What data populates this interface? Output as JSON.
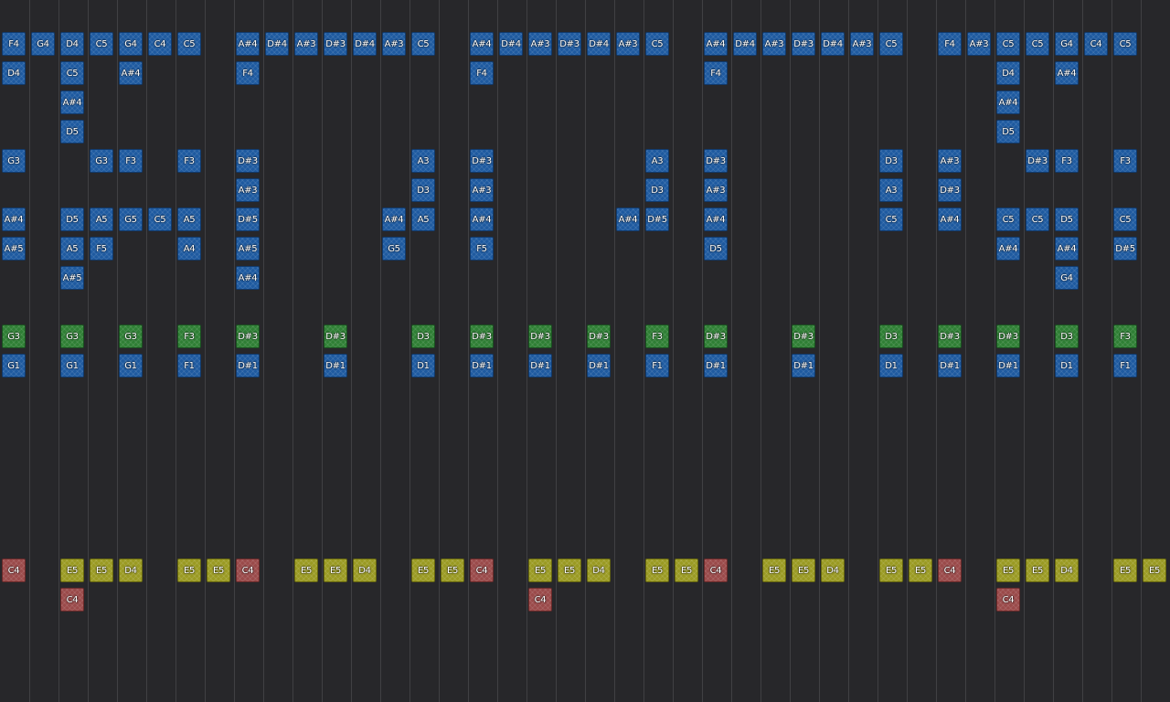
{
  "palette": {
    "background": "#27272a",
    "grid_line": "#404043",
    "blue": "#1e5aa0",
    "green": "#2f7f35",
    "yellow": "#9a9a22",
    "red": "#9a4a4a"
  },
  "columns": 40,
  "notes": [
    {
      "c": 0,
      "r": 0,
      "t": "F4",
      "k": "blue"
    },
    {
      "c": 1,
      "r": 0,
      "t": "G4",
      "k": "blue"
    },
    {
      "c": 2,
      "r": 0,
      "t": "D4",
      "k": "blue"
    },
    {
      "c": 3,
      "r": 0,
      "t": "C5",
      "k": "blue"
    },
    {
      "c": 4,
      "r": 0,
      "t": "G4",
      "k": "blue"
    },
    {
      "c": 5,
      "r": 0,
      "t": "C4",
      "k": "blue"
    },
    {
      "c": 6,
      "r": 0,
      "t": "C5",
      "k": "blue"
    },
    {
      "c": 8,
      "r": 0,
      "t": "A#4",
      "k": "blue"
    },
    {
      "c": 9,
      "r": 0,
      "t": "D#4",
      "k": "blue"
    },
    {
      "c": 10,
      "r": 0,
      "t": "A#3",
      "k": "blue"
    },
    {
      "c": 11,
      "r": 0,
      "t": "D#3",
      "k": "blue"
    },
    {
      "c": 12,
      "r": 0,
      "t": "D#4",
      "k": "blue"
    },
    {
      "c": 13,
      "r": 0,
      "t": "A#3",
      "k": "blue"
    },
    {
      "c": 14,
      "r": 0,
      "t": "C5",
      "k": "blue"
    },
    {
      "c": 16,
      "r": 0,
      "t": "A#4",
      "k": "blue"
    },
    {
      "c": 17,
      "r": 0,
      "t": "D#4",
      "k": "blue"
    },
    {
      "c": 18,
      "r": 0,
      "t": "A#3",
      "k": "blue"
    },
    {
      "c": 19,
      "r": 0,
      "t": "D#3",
      "k": "blue"
    },
    {
      "c": 20,
      "r": 0,
      "t": "D#4",
      "k": "blue"
    },
    {
      "c": 21,
      "r": 0,
      "t": "A#3",
      "k": "blue"
    },
    {
      "c": 22,
      "r": 0,
      "t": "C5",
      "k": "blue"
    },
    {
      "c": 24,
      "r": 0,
      "t": "A#4",
      "k": "blue"
    },
    {
      "c": 25,
      "r": 0,
      "t": "D#4",
      "k": "blue"
    },
    {
      "c": 26,
      "r": 0,
      "t": "A#3",
      "k": "blue"
    },
    {
      "c": 27,
      "r": 0,
      "t": "D#3",
      "k": "blue"
    },
    {
      "c": 28,
      "r": 0,
      "t": "D#4",
      "k": "blue"
    },
    {
      "c": 29,
      "r": 0,
      "t": "A#3",
      "k": "blue"
    },
    {
      "c": 30,
      "r": 0,
      "t": "C5",
      "k": "blue"
    },
    {
      "c": 32,
      "r": 0,
      "t": "F4",
      "k": "blue"
    },
    {
      "c": 33,
      "r": 0,
      "t": "A#3",
      "k": "blue"
    },
    {
      "c": 34,
      "r": 0,
      "t": "C5",
      "k": "blue"
    },
    {
      "c": 35,
      "r": 0,
      "t": "C5",
      "k": "blue"
    },
    {
      "c": 36,
      "r": 0,
      "t": "G4",
      "k": "blue"
    },
    {
      "c": 37,
      "r": 0,
      "t": "C4",
      "k": "blue"
    },
    {
      "c": 38,
      "r": 0,
      "t": "C5",
      "k": "blue"
    },
    {
      "c": 0,
      "r": 1,
      "t": "D4",
      "k": "blue"
    },
    {
      "c": 2,
      "r": 1,
      "t": "C5",
      "k": "blue"
    },
    {
      "c": 4,
      "r": 1,
      "t": "A#4",
      "k": "blue"
    },
    {
      "c": 8,
      "r": 1,
      "t": "F4",
      "k": "blue"
    },
    {
      "c": 16,
      "r": 1,
      "t": "F4",
      "k": "blue"
    },
    {
      "c": 24,
      "r": 1,
      "t": "F4",
      "k": "blue"
    },
    {
      "c": 34,
      "r": 1,
      "t": "D4",
      "k": "blue"
    },
    {
      "c": 36,
      "r": 1,
      "t": "A#4",
      "k": "blue"
    },
    {
      "c": 2,
      "r": 2,
      "t": "A#4",
      "k": "blue"
    },
    {
      "c": 34,
      "r": 2,
      "t": "A#4",
      "k": "blue"
    },
    {
      "c": 2,
      "r": 3,
      "t": "D5",
      "k": "blue"
    },
    {
      "c": 34,
      "r": 3,
      "t": "D5",
      "k": "blue"
    },
    {
      "c": 0,
      "r": 4,
      "t": "G3",
      "k": "blue"
    },
    {
      "c": 3,
      "r": 4,
      "t": "G3",
      "k": "blue"
    },
    {
      "c": 4,
      "r": 4,
      "t": "F3",
      "k": "blue"
    },
    {
      "c": 6,
      "r": 4,
      "t": "F3",
      "k": "blue"
    },
    {
      "c": 8,
      "r": 4,
      "t": "D#3",
      "k": "blue"
    },
    {
      "c": 14,
      "r": 4,
      "t": "A3",
      "k": "blue"
    },
    {
      "c": 16,
      "r": 4,
      "t": "D#3",
      "k": "blue"
    },
    {
      "c": 22,
      "r": 4,
      "t": "A3",
      "k": "blue"
    },
    {
      "c": 24,
      "r": 4,
      "t": "D#3",
      "k": "blue"
    },
    {
      "c": 30,
      "r": 4,
      "t": "D3",
      "k": "blue"
    },
    {
      "c": 32,
      "r": 4,
      "t": "A#3",
      "k": "blue"
    },
    {
      "c": 35,
      "r": 4,
      "t": "D#3",
      "k": "blue"
    },
    {
      "c": 36,
      "r": 4,
      "t": "F3",
      "k": "blue"
    },
    {
      "c": 38,
      "r": 4,
      "t": "F3",
      "k": "blue"
    },
    {
      "c": 8,
      "r": 5,
      "t": "A#3",
      "k": "blue"
    },
    {
      "c": 14,
      "r": 5,
      "t": "D3",
      "k": "blue"
    },
    {
      "c": 16,
      "r": 5,
      "t": "A#3",
      "k": "blue"
    },
    {
      "c": 22,
      "r": 5,
      "t": "D3",
      "k": "blue"
    },
    {
      "c": 24,
      "r": 5,
      "t": "A#3",
      "k": "blue"
    },
    {
      "c": 30,
      "r": 5,
      "t": "A3",
      "k": "blue"
    },
    {
      "c": 32,
      "r": 5,
      "t": "D#3",
      "k": "blue"
    },
    {
      "c": 0,
      "r": 6,
      "t": "A#4",
      "k": "blue"
    },
    {
      "c": 2,
      "r": 6,
      "t": "D5",
      "k": "blue"
    },
    {
      "c": 3,
      "r": 6,
      "t": "A5",
      "k": "blue"
    },
    {
      "c": 4,
      "r": 6,
      "t": "G5",
      "k": "blue"
    },
    {
      "c": 5,
      "r": 6,
      "t": "C5",
      "k": "blue"
    },
    {
      "c": 6,
      "r": 6,
      "t": "A5",
      "k": "blue"
    },
    {
      "c": 8,
      "r": 6,
      "t": "D#5",
      "k": "blue"
    },
    {
      "c": 13,
      "r": 6,
      "t": "A#4",
      "k": "blue"
    },
    {
      "c": 14,
      "r": 6,
      "t": "A5",
      "k": "blue"
    },
    {
      "c": 16,
      "r": 6,
      "t": "A#4",
      "k": "blue"
    },
    {
      "c": 21,
      "r": 6,
      "t": "A#4",
      "k": "blue"
    },
    {
      "c": 22,
      "r": 6,
      "t": "D#5",
      "k": "blue"
    },
    {
      "c": 24,
      "r": 6,
      "t": "A#4",
      "k": "blue"
    },
    {
      "c": 30,
      "r": 6,
      "t": "C5",
      "k": "blue"
    },
    {
      "c": 32,
      "r": 6,
      "t": "A#4",
      "k": "blue"
    },
    {
      "c": 34,
      "r": 6,
      "t": "C5",
      "k": "blue"
    },
    {
      "c": 35,
      "r": 6,
      "t": "C5",
      "k": "blue"
    },
    {
      "c": 36,
      "r": 6,
      "t": "D5",
      "k": "blue"
    },
    {
      "c": 38,
      "r": 6,
      "t": "C5",
      "k": "blue"
    },
    {
      "c": 0,
      "r": 7,
      "t": "A#5",
      "k": "blue"
    },
    {
      "c": 2,
      "r": 7,
      "t": "A5",
      "k": "blue"
    },
    {
      "c": 3,
      "r": 7,
      "t": "F5",
      "k": "blue"
    },
    {
      "c": 6,
      "r": 7,
      "t": "A4",
      "k": "blue"
    },
    {
      "c": 8,
      "r": 7,
      "t": "A#5",
      "k": "blue"
    },
    {
      "c": 13,
      "r": 7,
      "t": "G5",
      "k": "blue"
    },
    {
      "c": 16,
      "r": 7,
      "t": "F5",
      "k": "blue"
    },
    {
      "c": 24,
      "r": 7,
      "t": "D5",
      "k": "blue"
    },
    {
      "c": 34,
      "r": 7,
      "t": "A#4",
      "k": "blue"
    },
    {
      "c": 36,
      "r": 7,
      "t": "A#4",
      "k": "blue"
    },
    {
      "c": 38,
      "r": 7,
      "t": "D#5",
      "k": "blue"
    },
    {
      "c": 2,
      "r": 8,
      "t": "A#5",
      "k": "blue"
    },
    {
      "c": 8,
      "r": 8,
      "t": "A#4",
      "k": "blue"
    },
    {
      "c": 36,
      "r": 8,
      "t": "G4",
      "k": "blue"
    },
    {
      "c": 0,
      "r": 10,
      "t": "G3",
      "k": "green"
    },
    {
      "c": 2,
      "r": 10,
      "t": "G3",
      "k": "green"
    },
    {
      "c": 4,
      "r": 10,
      "t": "G3",
      "k": "green"
    },
    {
      "c": 6,
      "r": 10,
      "t": "F3",
      "k": "green"
    },
    {
      "c": 8,
      "r": 10,
      "t": "D#3",
      "k": "green"
    },
    {
      "c": 11,
      "r": 10,
      "t": "D#3",
      "k": "green"
    },
    {
      "c": 14,
      "r": 10,
      "t": "D3",
      "k": "green"
    },
    {
      "c": 16,
      "r": 10,
      "t": "D#3",
      "k": "green"
    },
    {
      "c": 18,
      "r": 10,
      "t": "D#3",
      "k": "green"
    },
    {
      "c": 20,
      "r": 10,
      "t": "D#3",
      "k": "green"
    },
    {
      "c": 22,
      "r": 10,
      "t": "F3",
      "k": "green"
    },
    {
      "c": 24,
      "r": 10,
      "t": "D#3",
      "k": "green"
    },
    {
      "c": 27,
      "r": 10,
      "t": "D#3",
      "k": "green"
    },
    {
      "c": 30,
      "r": 10,
      "t": "D3",
      "k": "green"
    },
    {
      "c": 32,
      "r": 10,
      "t": "D#3",
      "k": "green"
    },
    {
      "c": 34,
      "r": 10,
      "t": "D#3",
      "k": "green"
    },
    {
      "c": 36,
      "r": 10,
      "t": "D3",
      "k": "green"
    },
    {
      "c": 38,
      "r": 10,
      "t": "F3",
      "k": "green"
    },
    {
      "c": 0,
      "r": 11,
      "t": "G1",
      "k": "blue"
    },
    {
      "c": 2,
      "r": 11,
      "t": "G1",
      "k": "blue"
    },
    {
      "c": 4,
      "r": 11,
      "t": "G1",
      "k": "blue"
    },
    {
      "c": 6,
      "r": 11,
      "t": "F1",
      "k": "blue"
    },
    {
      "c": 8,
      "r": 11,
      "t": "D#1",
      "k": "blue"
    },
    {
      "c": 11,
      "r": 11,
      "t": "D#1",
      "k": "blue"
    },
    {
      "c": 14,
      "r": 11,
      "t": "D1",
      "k": "blue"
    },
    {
      "c": 16,
      "r": 11,
      "t": "D#1",
      "k": "blue"
    },
    {
      "c": 18,
      "r": 11,
      "t": "D#1",
      "k": "blue"
    },
    {
      "c": 20,
      "r": 11,
      "t": "D#1",
      "k": "blue"
    },
    {
      "c": 22,
      "r": 11,
      "t": "F1",
      "k": "blue"
    },
    {
      "c": 24,
      "r": 11,
      "t": "D#1",
      "k": "blue"
    },
    {
      "c": 27,
      "r": 11,
      "t": "D#1",
      "k": "blue"
    },
    {
      "c": 30,
      "r": 11,
      "t": "D1",
      "k": "blue"
    },
    {
      "c": 32,
      "r": 11,
      "t": "D#1",
      "k": "blue"
    },
    {
      "c": 34,
      "r": 11,
      "t": "D#1",
      "k": "blue"
    },
    {
      "c": 36,
      "r": 11,
      "t": "D1",
      "k": "blue"
    },
    {
      "c": 38,
      "r": 11,
      "t": "F1",
      "k": "blue"
    },
    {
      "c": 0,
      "r": 18,
      "t": "C4",
      "k": "red"
    },
    {
      "c": 2,
      "r": 18,
      "t": "E5",
      "k": "yellow"
    },
    {
      "c": 3,
      "r": 18,
      "t": "E5",
      "k": "yellow"
    },
    {
      "c": 4,
      "r": 18,
      "t": "D4",
      "k": "yellow"
    },
    {
      "c": 6,
      "r": 18,
      "t": "E5",
      "k": "yellow"
    },
    {
      "c": 7,
      "r": 18,
      "t": "E5",
      "k": "yellow"
    },
    {
      "c": 8,
      "r": 18,
      "t": "C4",
      "k": "red"
    },
    {
      "c": 10,
      "r": 18,
      "t": "E5",
      "k": "yellow"
    },
    {
      "c": 11,
      "r": 18,
      "t": "E5",
      "k": "yellow"
    },
    {
      "c": 12,
      "r": 18,
      "t": "D4",
      "k": "yellow"
    },
    {
      "c": 14,
      "r": 18,
      "t": "E5",
      "k": "yellow"
    },
    {
      "c": 15,
      "r": 18,
      "t": "E5",
      "k": "yellow"
    },
    {
      "c": 16,
      "r": 18,
      "t": "C4",
      "k": "red"
    },
    {
      "c": 18,
      "r": 18,
      "t": "E5",
      "k": "yellow"
    },
    {
      "c": 19,
      "r": 18,
      "t": "E5",
      "k": "yellow"
    },
    {
      "c": 20,
      "r": 18,
      "t": "D4",
      "k": "yellow"
    },
    {
      "c": 22,
      "r": 18,
      "t": "E5",
      "k": "yellow"
    },
    {
      "c": 23,
      "r": 18,
      "t": "E5",
      "k": "yellow"
    },
    {
      "c": 24,
      "r": 18,
      "t": "C4",
      "k": "red"
    },
    {
      "c": 26,
      "r": 18,
      "t": "E5",
      "k": "yellow"
    },
    {
      "c": 27,
      "r": 18,
      "t": "E5",
      "k": "yellow"
    },
    {
      "c": 28,
      "r": 18,
      "t": "D4",
      "k": "yellow"
    },
    {
      "c": 30,
      "r": 18,
      "t": "E5",
      "k": "yellow"
    },
    {
      "c": 31,
      "r": 18,
      "t": "E5",
      "k": "yellow"
    },
    {
      "c": 32,
      "r": 18,
      "t": "C4",
      "k": "red"
    },
    {
      "c": 34,
      "r": 18,
      "t": "E5",
      "k": "yellow"
    },
    {
      "c": 35,
      "r": 18,
      "t": "E5",
      "k": "yellow"
    },
    {
      "c": 36,
      "r": 18,
      "t": "D4",
      "k": "yellow"
    },
    {
      "c": 38,
      "r": 18,
      "t": "E5",
      "k": "yellow"
    },
    {
      "c": 39,
      "r": 18,
      "t": "E5",
      "k": "yellow"
    },
    {
      "c": 2,
      "r": 19,
      "t": "C4",
      "k": "red"
    },
    {
      "c": 18,
      "r": 19,
      "t": "C4",
      "k": "red"
    },
    {
      "c": 34,
      "r": 19,
      "t": "C4",
      "k": "red"
    }
  ]
}
